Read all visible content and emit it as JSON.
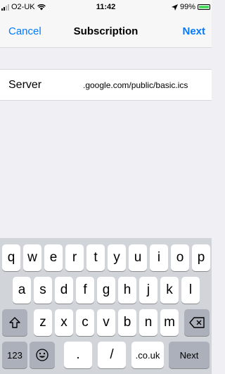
{
  "status_bar": {
    "carrier": "O2-UK",
    "time": "11:42",
    "battery_percent": "99%",
    "wifi_icon": "wifi-icon",
    "location_icon": "location-arrow-icon",
    "battery_level": 0.99,
    "battery_color": "#4cd964"
  },
  "nav": {
    "cancel_label": "Cancel",
    "title": "Subscription",
    "next_label": "Next",
    "accent": "#007aff"
  },
  "form": {
    "server_label": "Server",
    "server_value": ".google.com/public/basic.ics"
  },
  "keyboard": {
    "row1": [
      "q",
      "w",
      "e",
      "r",
      "t",
      "y",
      "u",
      "i",
      "o",
      "p"
    ],
    "row2": [
      "a",
      "s",
      "d",
      "f",
      "g",
      "h",
      "j",
      "k",
      "l"
    ],
    "row3": [
      "z",
      "x",
      "c",
      "v",
      "b",
      "n",
      "m"
    ],
    "shift_icon": "shift-icon",
    "delete_icon": "delete-icon",
    "emoji_icon": "emoji-icon",
    "numbers_label": "123",
    "dot_label": ".",
    "slash_label": "/",
    "domain_label": ".co.uk",
    "return_label": "Next"
  }
}
